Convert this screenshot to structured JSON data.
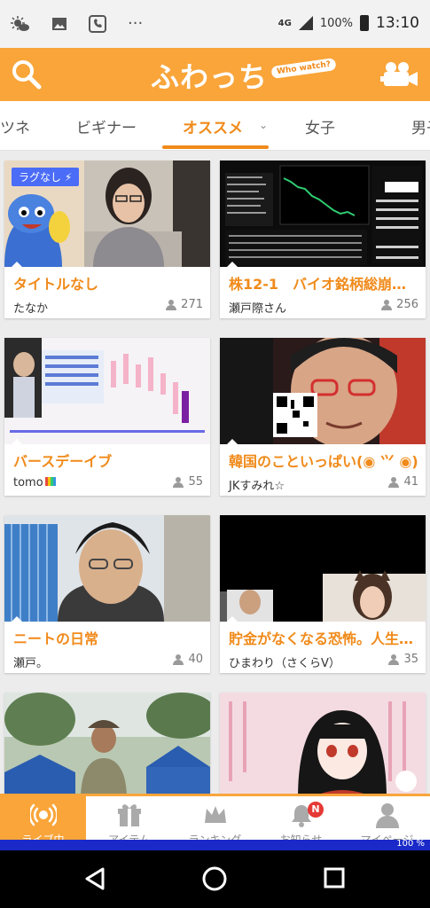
{
  "status_bar": {
    "network": "4G",
    "battery_percent": "100%",
    "time": "13:10",
    "dots": "···"
  },
  "header": {
    "logo_text": "ふわっち",
    "logo_bubble": "Who watch?",
    "accent_color": "#f9a53a"
  },
  "tabs": [
    {
      "label": "ツネ"
    },
    {
      "label": "ビギナー"
    },
    {
      "label": "オススメ",
      "active": true
    },
    {
      "label": "女子"
    },
    {
      "label": "男子"
    }
  ],
  "cards": [
    {
      "title": "タイトルなし",
      "user": "たなか",
      "viewers": "271",
      "badge": "ラグなし"
    },
    {
      "title": "株12-1　バイオ銘柄総崩れ…",
      "user": "瀬戸際さん",
      "viewers": "256"
    },
    {
      "title": "バースデーイブ",
      "user": "tomo",
      "viewers": "55"
    },
    {
      "title": "韓国のこといっぱい(◉ ⺍ ◉)",
      "user": "JKすみれ☆",
      "viewers": "41"
    },
    {
      "title": "ニートの日常",
      "user": "瀬戸。",
      "viewers": "40"
    },
    {
      "title": "貯金がなくなる恐怖。人生…",
      "user": "ひまわり（さくらV）",
      "viewers": "35"
    },
    {
      "title": "",
      "user": "",
      "viewers": ""
    },
    {
      "title": "",
      "user": "",
      "viewers": ""
    }
  ],
  "bottom_nav": [
    {
      "label": "ライブ中",
      "icon": "live-icon",
      "active": true
    },
    {
      "label": "アイテム",
      "icon": "gift-icon"
    },
    {
      "label": "ランキング",
      "icon": "crown-icon"
    },
    {
      "label": "お知らせ",
      "icon": "bell-icon",
      "badge": "N"
    },
    {
      "label": "マイページ",
      "icon": "person-icon"
    }
  ],
  "progress": {
    "label": "100 %",
    "value": 100
  }
}
